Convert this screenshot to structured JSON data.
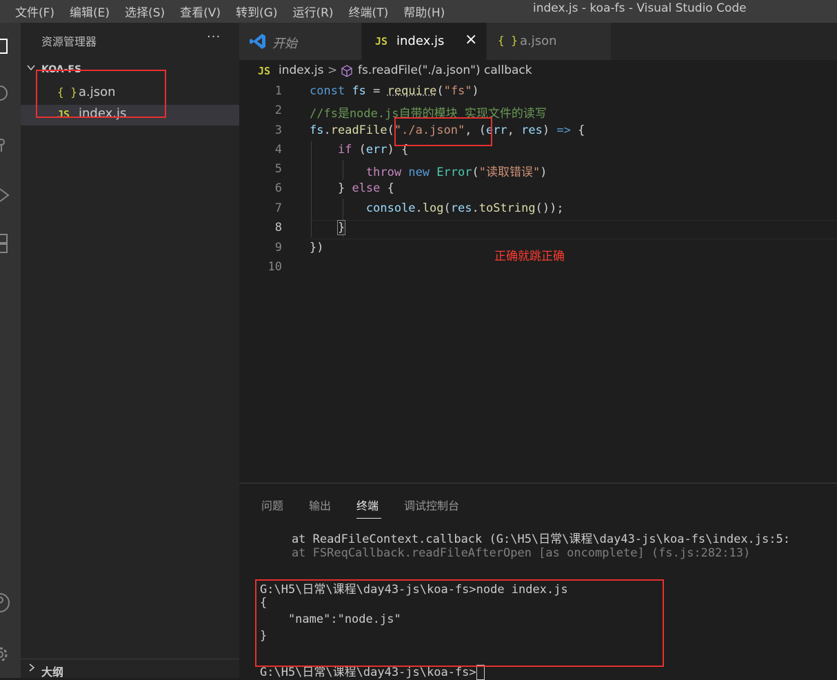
{
  "menu": [
    "文件(F)",
    "编辑(E)",
    "选择(S)",
    "查看(V)",
    "转到(G)",
    "运行(R)",
    "终端(T)",
    "帮助(H)"
  ],
  "window_title": "index.js - koa-fs - Visual Studio Code",
  "sidebar": {
    "title": "资源管理器",
    "more": "···",
    "folder": "KOA-FS",
    "files": [
      {
        "icon": "{ }",
        "name": "a.json"
      },
      {
        "icon": "JS",
        "name": "index.js"
      }
    ],
    "outline": "大纲"
  },
  "tabs": [
    {
      "icon": "vscode-logo-icon",
      "label": "开始"
    },
    {
      "icon": "JS",
      "label": "index.js",
      "close": "×"
    },
    {
      "icon": "{ }",
      "label": "a.json"
    }
  ],
  "breadcrumb": {
    "file_icon": "JS",
    "file": "index.js",
    "separator": ">",
    "symbol_icon": "cube-icon",
    "symbol": "fs.readFile(\"./a.json\") callback"
  },
  "code_lines": [
    "const fs = require(\"fs\")",
    "//fs是node.js自带的模块 实现文件的读写",
    "fs.readFile(\"./a.json\", (err, res) => {",
    "    if (err) {",
    "        throw new Error(\"读取错误\")",
    "    } else {",
    "        console.log(res.toString());",
    "    }",
    "})",
    ""
  ],
  "line_numbers": [
    "1",
    "2",
    "3",
    "4",
    "5",
    "6",
    "7",
    "8",
    "9",
    "10"
  ],
  "annotation": "正确就跳正确",
  "panel": {
    "tabs": [
      "问题",
      "输出",
      "终端",
      "调试控制台"
    ],
    "active_tab": "终端",
    "terminal": {
      "line1": "    at ReadFileContext.callback (G:\\H5\\日常\\课程\\day43-js\\koa-fs\\index.js:5:",
      "line2": "    at FSReqCallback.readFileAfterOpen [as oncomplete] (fs.js:282:13)",
      "line3": "G:\\H5\\日常\\课程\\day43-js\\koa-fs>node index.js",
      "line4": "{",
      "line5": "    \"name\":\"node.js\"",
      "line6": "}",
      "line7": "G:\\H5\\日常\\课程\\day43-js\\koa-fs>"
    }
  },
  "colors": {
    "annotation_red": "#e8302f",
    "editor_bg": "#1e1e1e",
    "sidebar_bg": "#252526",
    "js_icon_yellow": "#cbcb41"
  }
}
